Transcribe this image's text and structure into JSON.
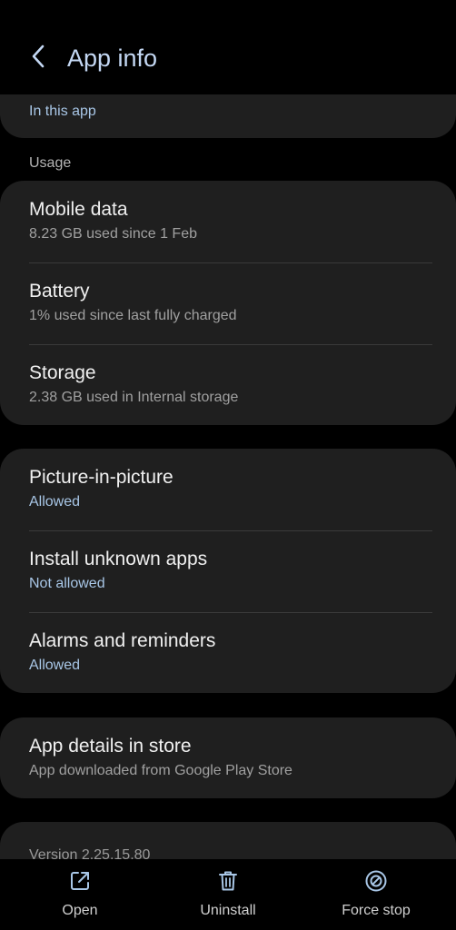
{
  "header": {
    "title": "App info"
  },
  "in_this_app": {
    "label": "In this app"
  },
  "usage": {
    "section_label": "Usage",
    "items": [
      {
        "title": "Mobile data",
        "subtitle": "8.23 GB used since 1 Feb"
      },
      {
        "title": "Battery",
        "subtitle": "1% used since last fully charged"
      },
      {
        "title": "Storage",
        "subtitle": "2.38 GB used in Internal storage"
      }
    ]
  },
  "permissions": {
    "items": [
      {
        "title": "Picture-in-picture",
        "subtitle": "Allowed"
      },
      {
        "title": "Install unknown apps",
        "subtitle": "Not allowed"
      },
      {
        "title": "Alarms and reminders",
        "subtitle": "Allowed"
      }
    ]
  },
  "store": {
    "title": "App details in store",
    "subtitle": "App downloaded from Google Play Store"
  },
  "version": {
    "text": "Version 2.25.15.80"
  },
  "bottom_bar": {
    "open_label": "Open",
    "uninstall_label": "Uninstall",
    "force_stop_label": "Force stop"
  },
  "colors": {
    "background": "#000000",
    "card": "#1f1f1f",
    "accent": "#a8c6e6",
    "title": "#c4d8f4"
  }
}
